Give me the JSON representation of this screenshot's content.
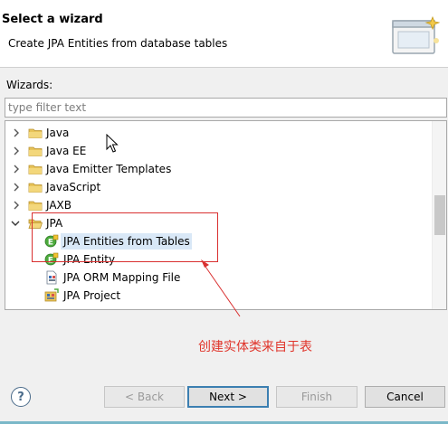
{
  "header": {
    "title": "Select a wizard",
    "description": "Create JPA Entities from database tables"
  },
  "wizards_label": "Wizards:",
  "filter": {
    "placeholder": "type filter text",
    "value": ""
  },
  "tree": {
    "items": [
      {
        "label": "Java",
        "expanded": false,
        "icon": "folder-icon"
      },
      {
        "label": "Java EE",
        "expanded": false,
        "icon": "folder-icon"
      },
      {
        "label": "Java Emitter Templates",
        "expanded": false,
        "icon": "folder-icon"
      },
      {
        "label": "JavaScript",
        "expanded": false,
        "icon": "folder-icon"
      },
      {
        "label": "JAXB",
        "expanded": false,
        "icon": "folder-icon"
      },
      {
        "label": "JPA",
        "expanded": true,
        "icon": "folder-icon"
      },
      {
        "label": "JPA Entities from Tables",
        "selected": true,
        "icon": "jpa-entity-icon"
      },
      {
        "label": "JPA Entity",
        "icon": "jpa-entity-icon"
      },
      {
        "label": "JPA ORM Mapping File",
        "icon": "orm-file-icon"
      },
      {
        "label": "JPA Project",
        "icon": "jpa-project-icon"
      }
    ]
  },
  "annotation": {
    "text": "创建实体类来自于表",
    "color": "#e0352b"
  },
  "buttons": {
    "back": "< Back",
    "next": "Next >",
    "finish": "Finish",
    "cancel": "Cancel"
  },
  "colors": {
    "selection": "#d9e8f7",
    "annotation_red": "#d93030",
    "folder": "#e8c45a"
  }
}
